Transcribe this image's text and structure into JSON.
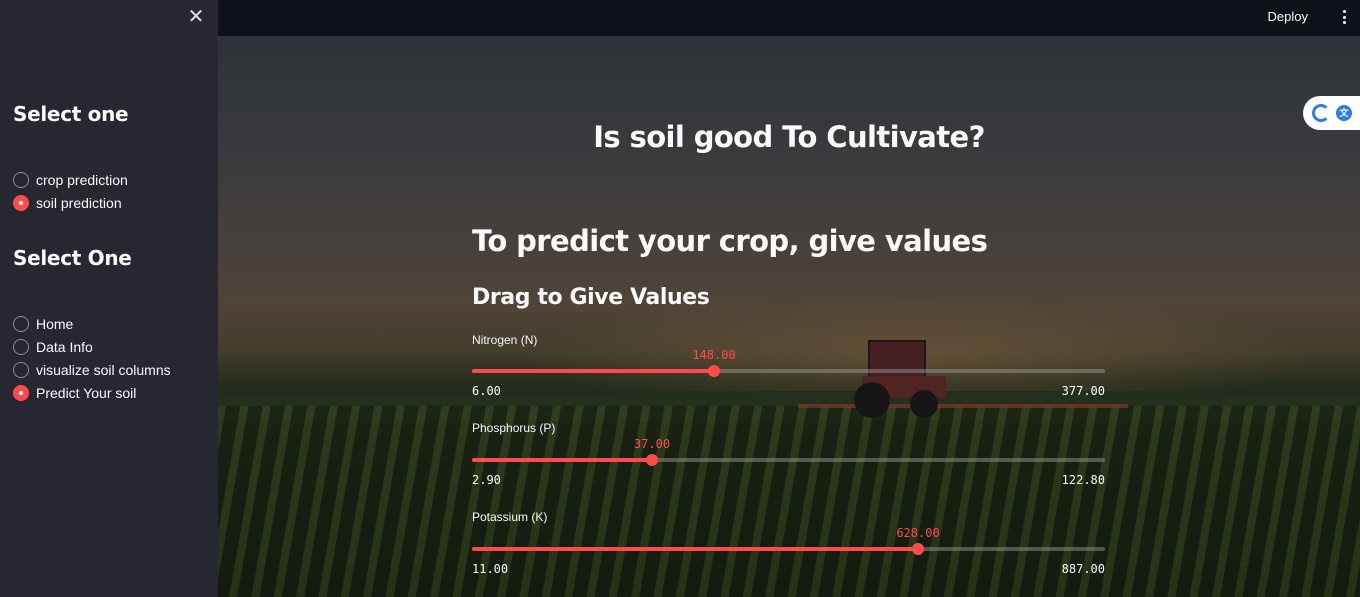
{
  "sidebar": {
    "heading1": "Select one",
    "group1": [
      {
        "label": "crop prediction",
        "selected": false
      },
      {
        "label": "soil prediction",
        "selected": true
      }
    ],
    "heading2": "Select One",
    "group2": [
      {
        "label": "Home",
        "selected": false
      },
      {
        "label": "Data Info",
        "selected": false
      },
      {
        "label": "visualize soil columns",
        "selected": false
      },
      {
        "label": "Predict Your soil",
        "selected": true
      }
    ],
    "close_icon": "close-icon"
  },
  "topbar": {
    "deploy_label": "Deploy",
    "menu_icon": "kebab-menu-icon"
  },
  "main": {
    "title": "Is soil good To Cultivate?",
    "subheading": "To predict your crop, give values",
    "section_heading": "Drag to Give Values",
    "sliders": [
      {
        "label": "Nitrogen (N)",
        "value": "148.00",
        "min": "6.00",
        "max": "377.00",
        "value_num": 148.0,
        "min_num": 6.0,
        "max_num": 377.0
      },
      {
        "label": "Phosphorus (P)",
        "value": "37.00",
        "min": "2.90",
        "max": "122.80",
        "value_num": 37.0,
        "min_num": 2.9,
        "max_num": 122.8
      },
      {
        "label": "Potassium (K)",
        "value": "628.00",
        "min": "11.00",
        "max": "887.00",
        "value_num": 628.0,
        "min_num": 11.0,
        "max_num": 887.0
      }
    ]
  },
  "colors": {
    "accent": "#ff4b4b",
    "sidebar_bg": "#262730",
    "app_bg": "#0e1117"
  }
}
